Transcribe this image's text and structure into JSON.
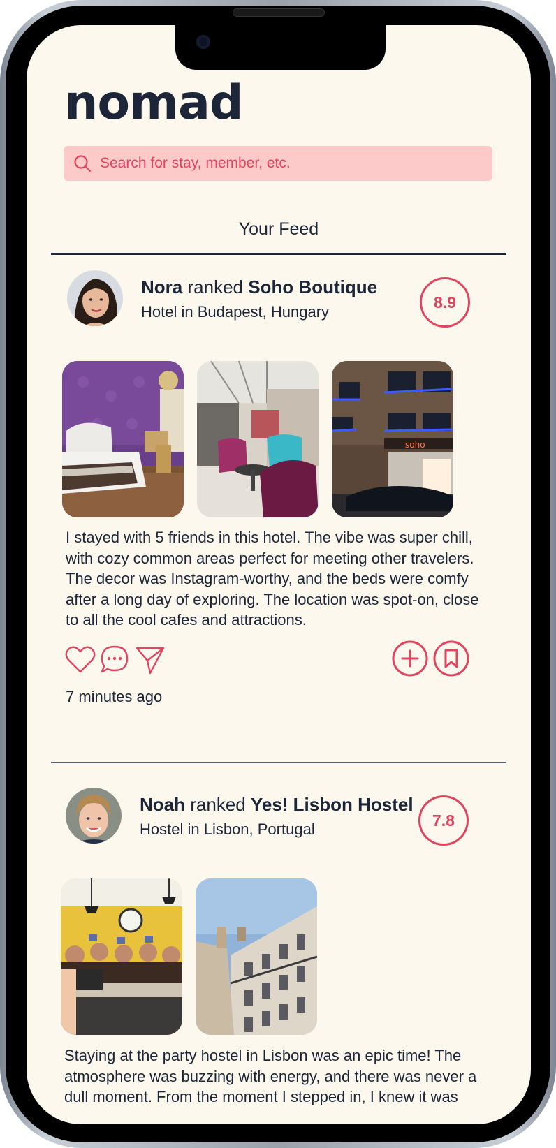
{
  "app": {
    "logo": "nomad"
  },
  "search": {
    "placeholder": "Search for stay, member, etc."
  },
  "feed": {
    "tab_label": "Your Feed"
  },
  "posts": [
    {
      "user": "Nora",
      "verb": "ranked",
      "place": "Soho Boutique",
      "subtitle": "Hotel in Budapest, Hungary",
      "score": "8.9",
      "body": "I stayed with 5 friends in this hotel. The vibe was super chill, with cozy common areas perfect for meeting other travelers. The decor was Instagram-worthy, and the beds were comfy after a long day of exploring. The location was spot-on, close to all the cool cafes and attractions.",
      "time": "7 minutes ago",
      "photos": [
        "hotel-room-purple",
        "hotel-lobby-chairs",
        "hotel-exterior-night"
      ]
    },
    {
      "user": "Noah",
      "verb": "ranked",
      "place": "Yes! Lisbon Hostel",
      "subtitle": "Hostel in Lisbon, Portugal",
      "score": "7.8",
      "body": "Staying at the party hostel in Lisbon was an epic time! The atmosphere was buzzing with energy, and there was never a dull moment. From the moment I stepped in, I knew it was",
      "photos": [
        "hostel-bar-crowd",
        "lisbon-street-buildings"
      ]
    }
  ],
  "colors": {
    "accent": "#e0445f",
    "ink": "#1c2638",
    "background": "#fdf8ee",
    "search_bg": "#fdcaca"
  }
}
